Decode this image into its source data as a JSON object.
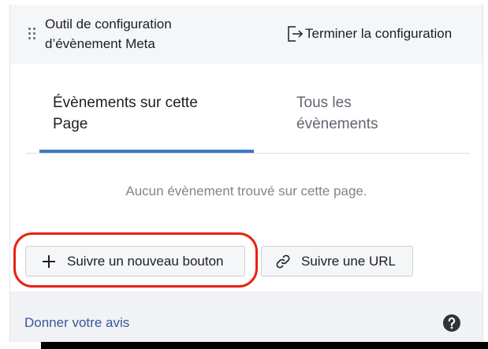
{
  "header": {
    "title": "Outil de configuration d’évènement Meta",
    "finish_label": "Terminer la configuration",
    "finish_icon": "exit-icon",
    "drag_icon": "drag-handle-icon"
  },
  "tabs": [
    {
      "label": "Évènements sur cette Page",
      "active": true
    },
    {
      "label": "Tous les évènements",
      "active": false
    }
  ],
  "empty_message": "Aucun évènement trouvé sur cette page.",
  "actions": {
    "new_button": {
      "label": "Suivre un nouveau bouton",
      "icon": "plus-icon"
    },
    "url_button": {
      "label": "Suivre une URL",
      "icon": "link-icon"
    }
  },
  "footer": {
    "feedback_label": "Donner votre avis",
    "help_icon": "help-icon"
  },
  "colors": {
    "accent": "#3b78c6",
    "highlight": "#e8220f",
    "link": "#385898"
  }
}
